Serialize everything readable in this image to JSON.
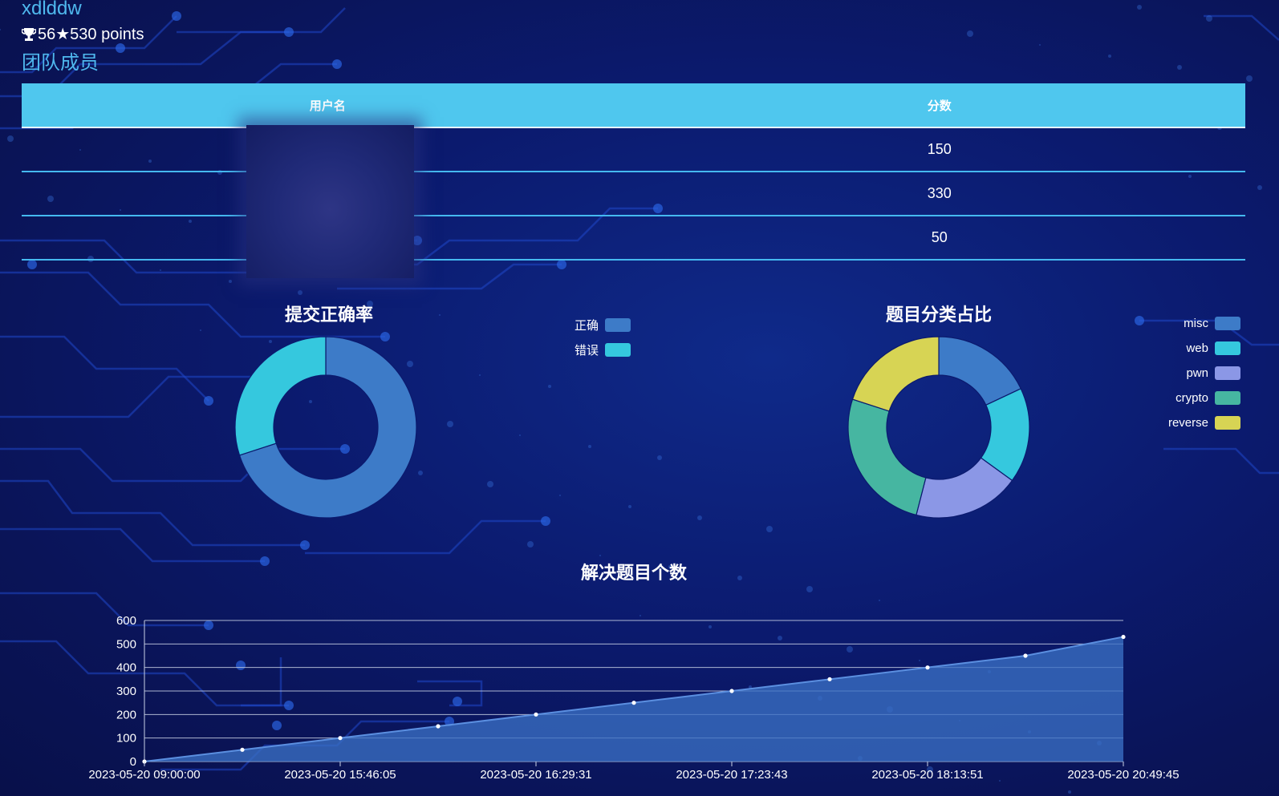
{
  "team": {
    "name": "xdlddw",
    "stats": "56★530 points",
    "members_label": "团队成员"
  },
  "members_table": {
    "columns": [
      "用户名",
      "分数"
    ],
    "rows": [
      {
        "username": "",
        "score": "150"
      },
      {
        "username": "",
        "score": "330"
      },
      {
        "username": "",
        "score": "50"
      }
    ]
  },
  "chart_data": [
    {
      "type": "pie",
      "title": "提交正确率",
      "donut": true,
      "categories": [
        "正确",
        "错误"
      ],
      "values": [
        70,
        30
      ],
      "colors": [
        "#3d7bc8",
        "#35c8de"
      ],
      "legend": "top-right"
    },
    {
      "type": "pie",
      "title": "题目分类占比",
      "donut": true,
      "categories": [
        "misc",
        "web",
        "pwn",
        "crypto",
        "reverse"
      ],
      "values": [
        18,
        17,
        19,
        26,
        20
      ],
      "colors": [
        "#3d7bc8",
        "#35c8de",
        "#8b97e6",
        "#46b6a1",
        "#d7d454"
      ],
      "legend": "top-right"
    },
    {
      "type": "area",
      "title": "解决题目个数",
      "x": [
        "2023-05-20 09:00:00",
        "",
        "2023-05-20 15:46:05",
        "",
        "2023-05-20 16:29:31",
        "",
        "2023-05-20 17:23:43",
        "",
        "2023-05-20 18:13:51",
        "",
        "2023-05-20 20:49:45"
      ],
      "x_tick_labels": [
        "2023-05-20 09:00:00",
        "2023-05-20 15:46:05",
        "2023-05-20 16:29:31",
        "2023-05-20 17:23:43",
        "2023-05-20 18:13:51",
        "2023-05-20 20:49:45"
      ],
      "values": [
        0,
        50,
        100,
        150,
        200,
        250,
        300,
        350,
        400,
        450,
        530
      ],
      "ylim": [
        0,
        600
      ],
      "y_ticks": [
        0,
        100,
        200,
        300,
        400,
        500,
        600
      ],
      "grid": true,
      "color": "#3a6fc4"
    }
  ]
}
